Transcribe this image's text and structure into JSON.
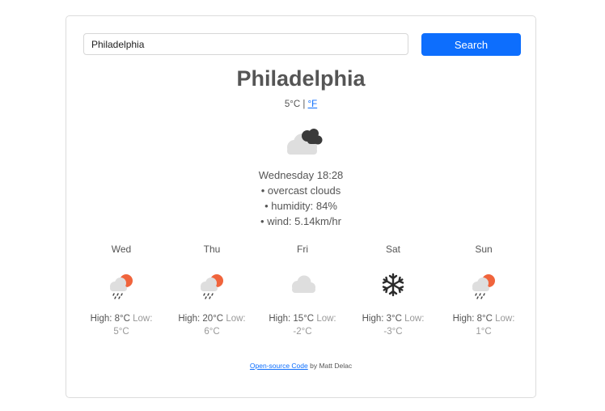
{
  "search": {
    "value": "Philadelphia",
    "button_label": "Search"
  },
  "current": {
    "city": "Philadelphia",
    "temperature": "5°C",
    "separator": "|",
    "unit_toggle": "°F",
    "condition_icon": "dark-cloud-icon",
    "datetime": "Wednesday 18:28",
    "details": [
      "• overcast clouds",
      "• humidity: 84%",
      "• wind: 5.14km/hr"
    ]
  },
  "forecast": [
    {
      "day": "Wed",
      "icon": "sun-cloud-rain-icon",
      "high": "High: 8°C",
      "low": "Low: 5°C"
    },
    {
      "day": "Thu",
      "icon": "sun-cloud-rain-icon",
      "high": "High: 20°C",
      "low": "Low: 6°C"
    },
    {
      "day": "Fri",
      "icon": "cloud-icon",
      "high": "High: 15°C",
      "low": "Low: -2°C"
    },
    {
      "day": "Sat",
      "icon": "snowflake-icon",
      "high": "High: 3°C",
      "low": "Low: -3°C"
    },
    {
      "day": "Sun",
      "icon": "sun-cloud-rain-icon",
      "high": "High: 8°C",
      "low": "Low: 1°C"
    }
  ],
  "footer": {
    "link_text": "Open-source Code",
    "rest": " by Matt Delac"
  },
  "colors": {
    "accent": "#0d6efd",
    "sun": "#f0643c",
    "cloud": "#dedede",
    "dark_cloud": "#3a3a3a"
  }
}
